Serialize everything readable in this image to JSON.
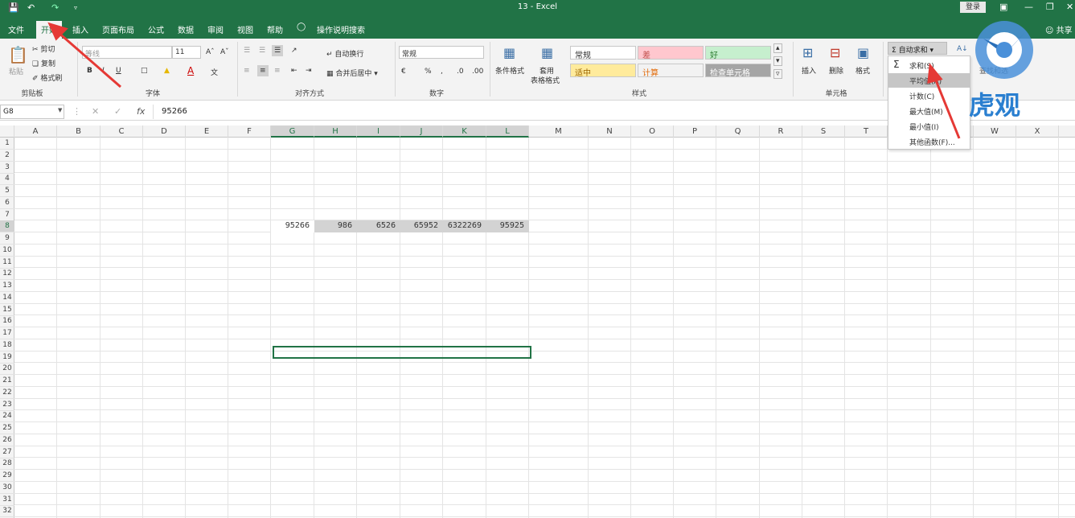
{
  "window": {
    "title": "13  -  Excel",
    "login_label": "登录",
    "share_label": "共享"
  },
  "tabs": [
    {
      "label": "文件"
    },
    {
      "label": "开始"
    },
    {
      "label": "插入"
    },
    {
      "label": "页面布局"
    },
    {
      "label": "公式"
    },
    {
      "label": "数据"
    },
    {
      "label": "审阅"
    },
    {
      "label": "视图"
    },
    {
      "label": "帮助"
    },
    {
      "label": "操作说明搜索"
    }
  ],
  "ribbon": {
    "clipboard": {
      "label": "剪贴板",
      "paste": "粘贴",
      "cut": "剪切",
      "copy": "复制",
      "format_painter": "格式刷"
    },
    "font": {
      "label": "字体",
      "font_name": "等线",
      "font_size": "11"
    },
    "alignment": {
      "label": "对齐方式",
      "wrap": "自动换行",
      "merge": "合并后居中"
    },
    "number": {
      "label": "数字",
      "format": "常规"
    },
    "styles": {
      "label": "样式",
      "conditional": "条件格式",
      "table_format_1": "套用",
      "table_format_2": "表格格式",
      "cells": [
        {
          "text": "常规",
          "bg": "#ffffff",
          "fg": "#333333"
        },
        {
          "text": "差",
          "bg": "#ffc7ce",
          "fg": "#c0504d"
        },
        {
          "text": "好",
          "bg": "#c6efce",
          "fg": "#2e7d32"
        },
        {
          "text": "适中",
          "bg": "#ffeb9c",
          "fg": "#9c6500"
        },
        {
          "text": "计算",
          "bg": "#f2f2f2",
          "fg": "#e36c0a"
        },
        {
          "text": "检查单元格",
          "bg": "#a5a5a5",
          "fg": "#ffffff"
        }
      ]
    },
    "cells": {
      "label": "单元格",
      "insert": "插入",
      "delete": "删除",
      "format": "格式"
    },
    "editing": {
      "autosum": "自动求和",
      "find_select": "查找和选"
    }
  },
  "autosum_menu": {
    "items": [
      {
        "label": "求和(S)"
      },
      {
        "label": "平均值(A)"
      },
      {
        "label": "计数(C)"
      },
      {
        "label": "最大值(M)"
      },
      {
        "label": "最小值(I)"
      },
      {
        "label": "其他函数(F)..."
      }
    ],
    "highlighted": "平均值(A)"
  },
  "formula_bar": {
    "name_box": "G8",
    "fx_label": "fx",
    "value": "95266"
  },
  "columns": [
    "A",
    "B",
    "C",
    "D",
    "E",
    "F",
    "G",
    "H",
    "I",
    "J",
    "K",
    "L",
    "M",
    "N",
    "O",
    "P",
    "Q",
    "R",
    "S",
    "T",
    "U",
    "V",
    "W",
    "X"
  ],
  "rows": [
    "1",
    "2",
    "3",
    "4",
    "5",
    "6",
    "7",
    "8",
    "9",
    "10",
    "11",
    "12",
    "13",
    "14",
    "15",
    "16",
    "17",
    "18",
    "19",
    "20",
    "21",
    "22",
    "23",
    "24",
    "25",
    "26",
    "27",
    "28",
    "29",
    "30",
    "31",
    "32"
  ],
  "selected_row": "8",
  "row8_values": [
    {
      "col": "G",
      "value": "95266"
    },
    {
      "col": "H",
      "value": "986"
    },
    {
      "col": "I",
      "value": "6526"
    },
    {
      "col": "J",
      "value": "65952"
    },
    {
      "col": "K",
      "value": "6322269"
    },
    {
      "col": "L",
      "value": "95925"
    }
  ],
  "logo": {
    "text": "虎观"
  },
  "colors": {
    "excel_green": "#217346",
    "arrow_red": "#e53935"
  }
}
